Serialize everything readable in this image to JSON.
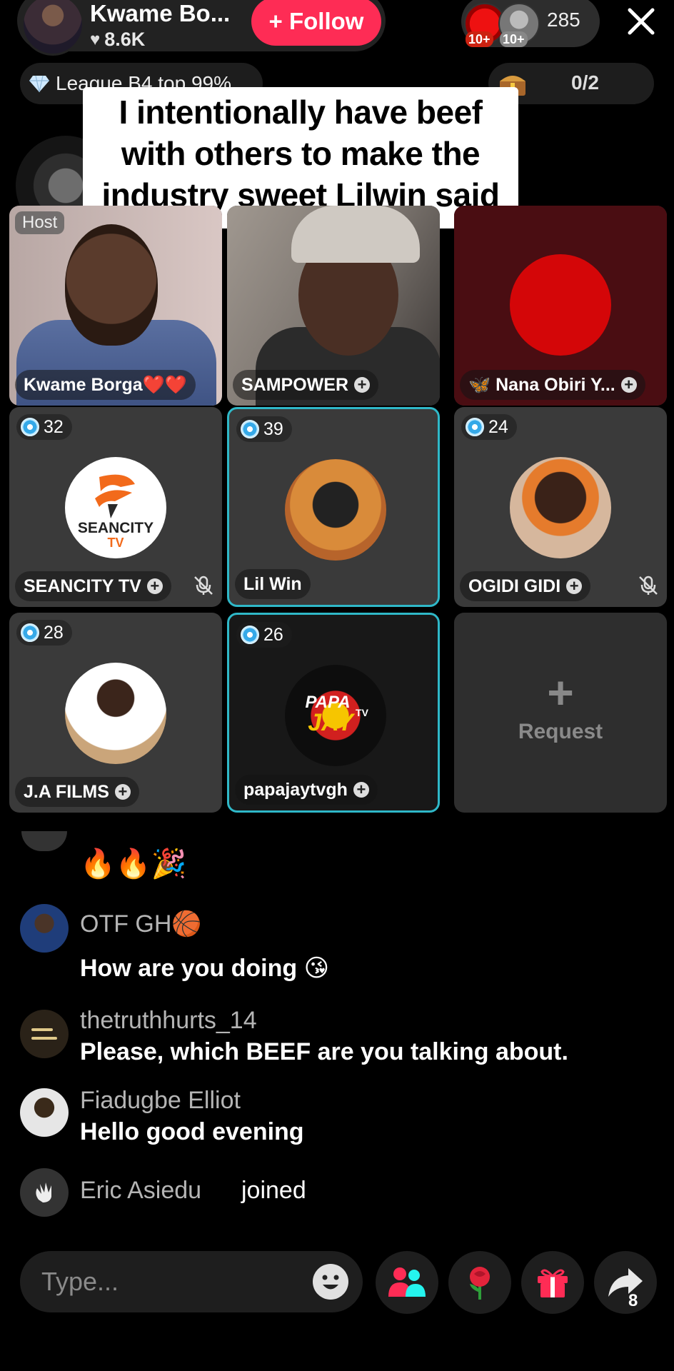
{
  "header": {
    "host_name": "Kwame Bo...",
    "likes": "8.6K",
    "follow_label": "+ Follow",
    "viewer_badges": [
      "10+",
      "10+"
    ],
    "viewer_count": "285",
    "league_label": "League B4 top 99%",
    "treasure_count": "0/2"
  },
  "caption": {
    "line1": "I intentionally have beef",
    "line2": "with others to make the",
    "line3": "industry sweet Lilwin said"
  },
  "grid": {
    "host_badge": "Host",
    "tiles": [
      {
        "name": "Kwame Borga❤️❤️",
        "score": ""
      },
      {
        "name": "SAMPOWER",
        "score": ""
      },
      {
        "name": "🦋 Nana Obiri Y...",
        "score": ""
      },
      {
        "name": "SEANCITY TV",
        "score": "32",
        "logo_line1": "SEANCITY",
        "logo_line2": "TV"
      },
      {
        "name": "Lil Win",
        "score": "39"
      },
      {
        "name": "OGIDI GIDI",
        "score": "24"
      },
      {
        "name": "J.A FILMS",
        "score": "28"
      },
      {
        "name": "papajaytvgh",
        "score": "26",
        "logo_line1": "PAPA",
        "logo_line2": "JAY",
        "logo_line3": "TV"
      },
      {
        "request_label": "Request"
      }
    ]
  },
  "comments": {
    "emoji_row": "🔥🔥🎉",
    "items": [
      {
        "user": "OTF GH🏀",
        "text": "How are you doing 😘"
      },
      {
        "user": "thetruthhurts_14",
        "text": "Please, which BEEF are you talking about."
      },
      {
        "user": "Fiadugbe Elliot",
        "text": "Hello good evening"
      },
      {
        "user": "Eric Asiedu",
        "text": "joined"
      }
    ]
  },
  "bottom": {
    "type_placeholder": "Type...",
    "share_count": "8"
  },
  "colors": {
    "follow": "#fe2c55",
    "selected_border": "#2fb8c8",
    "background": "#000000"
  }
}
